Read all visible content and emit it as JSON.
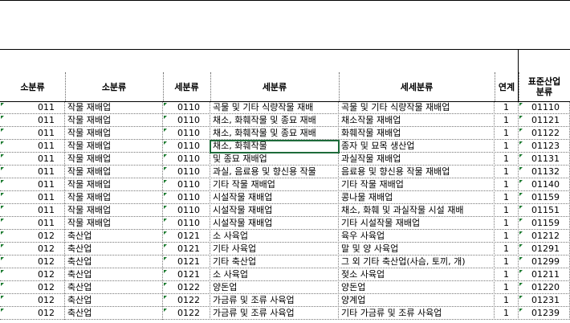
{
  "headers": {
    "sobunryu_code": "소분류",
    "sobunryu_name": "소분류",
    "sebunryu_code": "세분류",
    "sebunryu_name": "세분류",
    "sesebunryu_name": "세세분류",
    "link": "연계",
    "std_line1": "표준산업",
    "std_line2": "분류"
  },
  "rows": [
    {
      "c1": "011",
      "c2": "작물 재배업",
      "c3": "0110",
      "c4": "곡물 및 기타 식량작물 재배",
      "c5": "곡물 및 기타 식량작물 재배업",
      "c6": "1",
      "c7": "01110"
    },
    {
      "c1": "011",
      "c2": "작물 재배업",
      "c3": "0110",
      "c4": "채소, 화훼작물 및 종묘 재배",
      "c5": "채소작물 재배업",
      "c6": "1",
      "c7": "01121"
    },
    {
      "c1": "011",
      "c2": "작물 재배업",
      "c3": "0110",
      "c4": "채소, 화훼작물 및 종묘 재배",
      "c5": "화훼작물 재배업",
      "c6": "1",
      "c7": "01122"
    },
    {
      "c1": "011",
      "c2": "작물 재배업",
      "c3": "0110",
      "c4": "채소, 화훼작물",
      "c5": "종자 및 묘목 생산업",
      "c6": "1",
      "c7": "01123"
    },
    {
      "c1": "011",
      "c2": "작물 재배업",
      "c3": "0110",
      "c4": "및 종묘 재배업",
      "c5": "과실작물 재배업",
      "c6": "1",
      "c7": "01131"
    },
    {
      "c1": "011",
      "c2": "작물 재배업",
      "c3": "0110",
      "c4": "과실, 음료용 및 향신용 작물",
      "c5": "음료용 및 향신용 작물 재배업",
      "c6": "1",
      "c7": "01132"
    },
    {
      "c1": "011",
      "c2": "작물 재배업",
      "c3": "0110",
      "c4": "기타 작물 재배업",
      "c5": "기타 작물 재배업",
      "c6": "1",
      "c7": "01140"
    },
    {
      "c1": "011",
      "c2": "작물 재배업",
      "c3": "0110",
      "c4": "시설작물 재배업",
      "c5": "콩나물 재배업",
      "c6": "1",
      "c7": "01159"
    },
    {
      "c1": "011",
      "c2": "작물 재배업",
      "c3": "0110",
      "c4": "시설작물 재배업",
      "c5": "채소, 화훼 및 과실작물 시설 재배",
      "c6": "1",
      "c7": "01151"
    },
    {
      "c1": "011",
      "c2": "작물 재배업",
      "c3": "0110",
      "c4": "시설작물 재배업",
      "c5": "기타 시설작물 재배업",
      "c6": "1",
      "c7": "01159"
    },
    {
      "c1": "012",
      "c2": "축산업",
      "c3": "0121",
      "c4": "소 사육업",
      "c5": "육우 사육업",
      "c6": "1",
      "c7": "01212"
    },
    {
      "c1": "012",
      "c2": "축산업",
      "c3": "0121",
      "c4": "기타 사육업",
      "c5": "말 및 양 사육업",
      "c6": "1",
      "c7": "01291"
    },
    {
      "c1": "012",
      "c2": "축산업",
      "c3": "0121",
      "c4": "기타 축산업",
      "c5": "그 외 기타 축산업(사슴, 토끼, 개)",
      "c6": "1",
      "c7": "01299"
    },
    {
      "c1": "012",
      "c2": "축산업",
      "c3": "0121",
      "c4": "소 사육업",
      "c5": "젖소 사육업",
      "c6": "1",
      "c7": "01211"
    },
    {
      "c1": "012",
      "c2": "축산업",
      "c3": "0122",
      "c4": "양돈업",
      "c5": "양돈업",
      "c6": "1",
      "c7": "01220"
    },
    {
      "c1": "012",
      "c2": "축산업",
      "c3": "0122",
      "c4": "가금류 및 조류 사육업",
      "c5": "양계업",
      "c6": "1",
      "c7": "01231"
    },
    {
      "c1": "012",
      "c2": "축산업",
      "c3": "0122",
      "c4": "가금류 및 조류 사육업",
      "c5": "기타 가금류 및 조류 사육업",
      "c6": "1",
      "c7": "01239"
    }
  ]
}
